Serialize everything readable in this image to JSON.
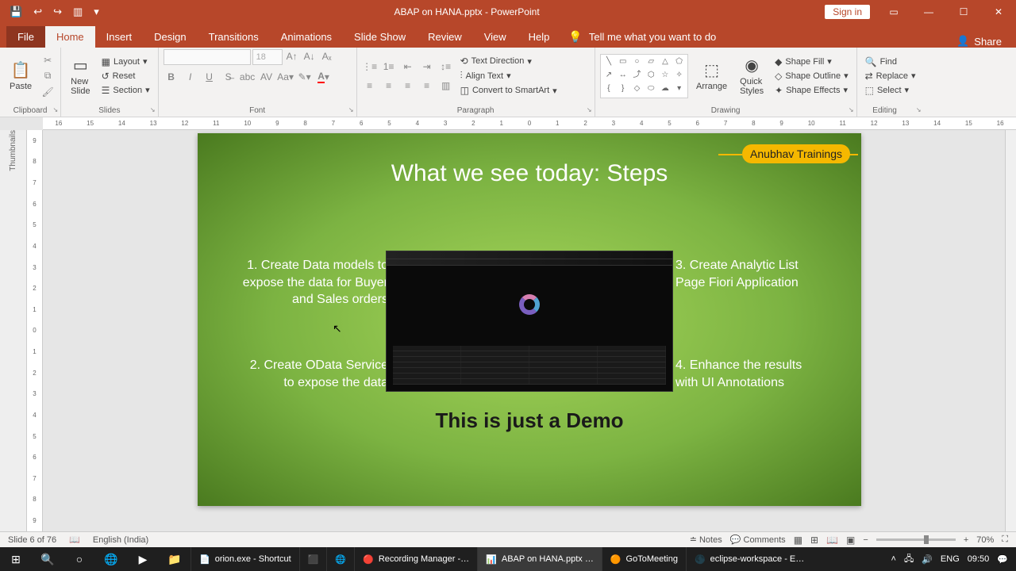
{
  "titlebar": {
    "title": "ABAP on HANA.pptx - PowerPoint",
    "signin": "Sign in"
  },
  "tabs": {
    "file": "File",
    "items": [
      "Home",
      "Insert",
      "Design",
      "Transitions",
      "Animations",
      "Slide Show",
      "Review",
      "View",
      "Help"
    ],
    "active": "Home",
    "tellme": "Tell me what you want to do",
    "share": "Share"
  },
  "ribbon": {
    "clipboard": {
      "label": "Clipboard",
      "paste": "Paste"
    },
    "slides": {
      "label": "Slides",
      "newslide": "New\nSlide",
      "layout": "Layout",
      "reset": "Reset",
      "section": "Section"
    },
    "font": {
      "label": "Font",
      "size": "18"
    },
    "paragraph": {
      "label": "Paragraph",
      "textdir": "Text Direction",
      "align": "Align Text",
      "smartart": "Convert to SmartArt"
    },
    "drawing": {
      "label": "Drawing",
      "arrange": "Arrange",
      "quick": "Quick\nStyles",
      "fill": "Shape Fill",
      "outline": "Shape Outline",
      "effects": "Shape Effects"
    },
    "editing": {
      "label": "Editing",
      "find": "Find",
      "replace": "Replace",
      "select": "Select"
    }
  },
  "thumbs": {
    "label": "Thumbnails"
  },
  "slide": {
    "title": "What we see today: Steps",
    "logo": "Anubhav Trainings",
    "step1": "1. Create Data models to expose the data for Buyer and Sales orders",
    "step2": "2. Create OData Service to expose the data",
    "step3": "3. Create Analytic List Page Fiori Application",
    "step4": "4. Enhance the results with UI Annotations",
    "demo": "This is just a Demo"
  },
  "status": {
    "slide": "Slide 6 of 76",
    "lang": "English (India)",
    "notes": "Notes",
    "comments": "Comments",
    "zoom": "70%"
  },
  "taskbar": {
    "items": [
      {
        "icon": "📄",
        "label": "orion.exe - Shortcut"
      },
      {
        "icon": "⬛",
        "label": ""
      },
      {
        "icon": "🌐",
        "label": ""
      },
      {
        "icon": "🔴",
        "label": "Recording Manager -…"
      },
      {
        "icon": "📊",
        "label": "ABAP on HANA.pptx …"
      },
      {
        "icon": "🟠",
        "label": "GoToMeeting"
      },
      {
        "icon": "🌑",
        "label": "eclipse-workspace - E…"
      }
    ],
    "tray": {
      "lang": "ENG",
      "time": "09:50"
    }
  }
}
